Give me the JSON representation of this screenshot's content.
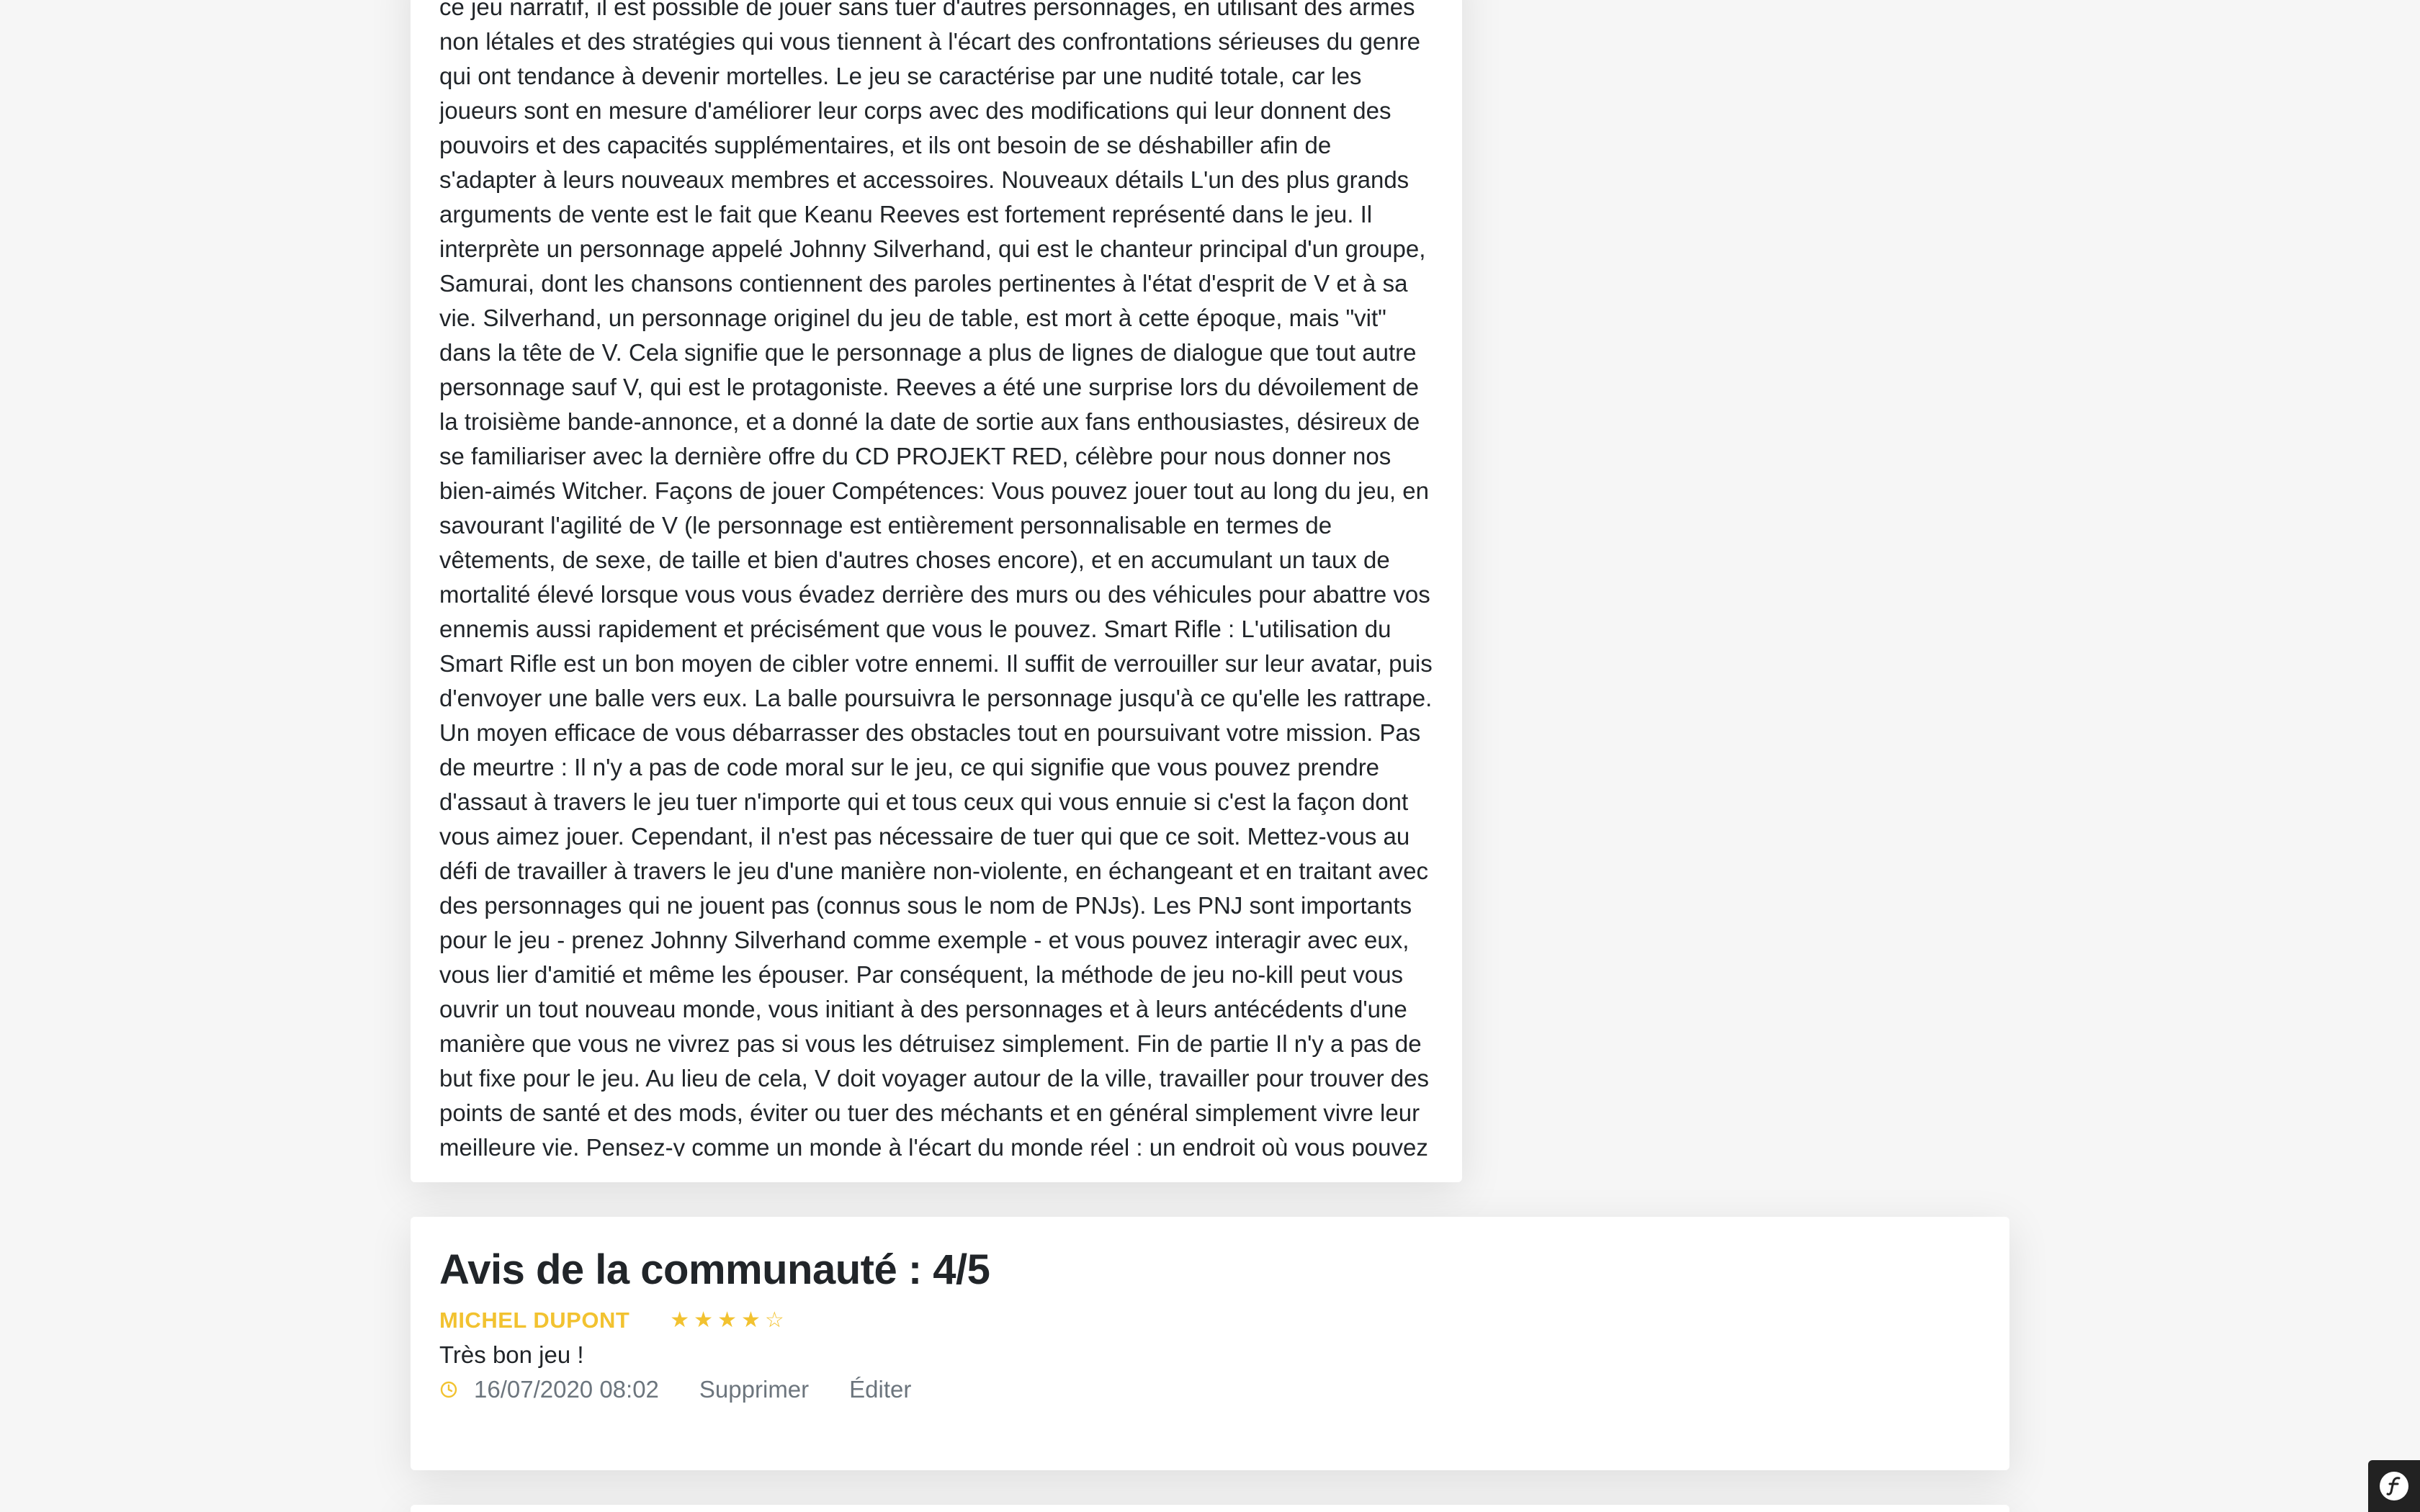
{
  "description": {
    "text": "ce jeu narratif, il est possible de jouer sans tuer d'autres personnages, en utilisant des armes non létales et des stratégies qui vous tiennent à l'écart des confrontations sérieuses du genre qui ont tendance à devenir mortelles. Le jeu se caractérise par une nudité totale, car les joueurs sont en mesure d'améliorer leur corps avec des modifications qui leur donnent des pouvoirs et des capacités supplémentaires, et ils ont besoin de se déshabiller afin de s'adapter à leurs nouveaux membres et accessoires. Nouveaux détails L'un des plus grands arguments de vente est le fait que Keanu Reeves est fortement représenté dans le jeu. Il interprète un personnage appelé Johnny Silverhand, qui est le chanteur principal d'un groupe, Samurai, dont les chansons contiennent des paroles pertinentes à l'état d'esprit de V et à sa vie. Silverhand, un personnage originel du jeu de table, est mort à cette époque, mais \"vit\" dans la tête de V. Cela signifie que le personnage a plus de lignes de dialogue que tout autre personnage sauf V, qui est le protagoniste. Reeves a été une surprise lors du dévoilement de la troisième bande-annonce, et a donné la date de sortie aux fans enthousiastes, désireux de se familiariser avec la dernière offre du CD PROJEKT RED, célèbre pour nous donner nos bien-aimés Witcher. Façons de jouer Compétences: Vous pouvez jouer tout au long du jeu, en savourant l'agilité de V (le personnage est entièrement personnalisable en termes de vêtements, de sexe, de taille et bien d'autres choses encore), et en accumulant un taux de mortalité élevé lorsque vous vous évadez derrière des murs ou des véhicules pour abattre vos ennemis aussi rapidement et précisément que vous le pouvez. Smart Rifle : L'utilisation du Smart Rifle est un bon moyen de cibler votre ennemi. Il suffit de verrouiller sur leur avatar, puis d'envoyer une balle vers eux. La balle poursuivra le personnage jusqu'à ce qu'elle les rattrape. Un moyen efficace de vous débarrasser des obstacles tout en poursuivant votre mission. Pas de meurtre : Il n'y a pas de code moral sur le jeu, ce qui signifie que vous pouvez prendre d'assaut à travers le jeu tuer n'importe qui et tous ceux qui vous ennuie si c'est la façon dont vous aimez jouer. Cependant, il n'est pas nécessaire de tuer qui que ce soit. Mettez-vous au défi de travailler à travers le jeu d'une manière non-violente, en échangeant et en traitant avec des personnages qui ne jouent pas (connus sous le nom de PNJs). Les PNJ sont importants pour le jeu - prenez Johnny Silverhand comme exemple - et vous pouvez interagir avec eux, vous lier d'amitié et même les épouser. Par conséquent, la méthode de jeu no-kill peut vous ouvrir un tout nouveau monde, vous initiant à des personnages et à leurs antécédents d'une manière que vous ne vivrez pas si vous les détruisez simplement. Fin de partie Il n'y a pas de but fixe pour le jeu. Au lieu de cela, V doit voyager autour de la ville, travailler pour trouver des points de santé et des mods, éviter ou tuer des méchants et en général simplement vivre leur meilleure vie. Pensez-y comme un monde à l'écart du monde réel : un endroit où vous pouvez être quelqu'un d'un peu différent."
  },
  "reviews": {
    "title": "Avis de la communauté : 4/5",
    "items": [
      {
        "author": "MICHEL DUPONT",
        "rating": 4,
        "max_rating": 5,
        "text": "Très bon jeu !",
        "date": "16/07/2020 08:02",
        "delete_label": "Supprimer",
        "edit_label": "Éditer"
      }
    ]
  },
  "icons": {
    "star_filled": "star-icon",
    "star_empty": "star-outline-icon",
    "clock": "clock-icon",
    "symfony": "symfony-logo-icon"
  },
  "colors": {
    "accent": "#f2c230",
    "text": "#212529",
    "muted": "#6c757d",
    "background": "#f6f6f6",
    "card": "#ffffff"
  }
}
